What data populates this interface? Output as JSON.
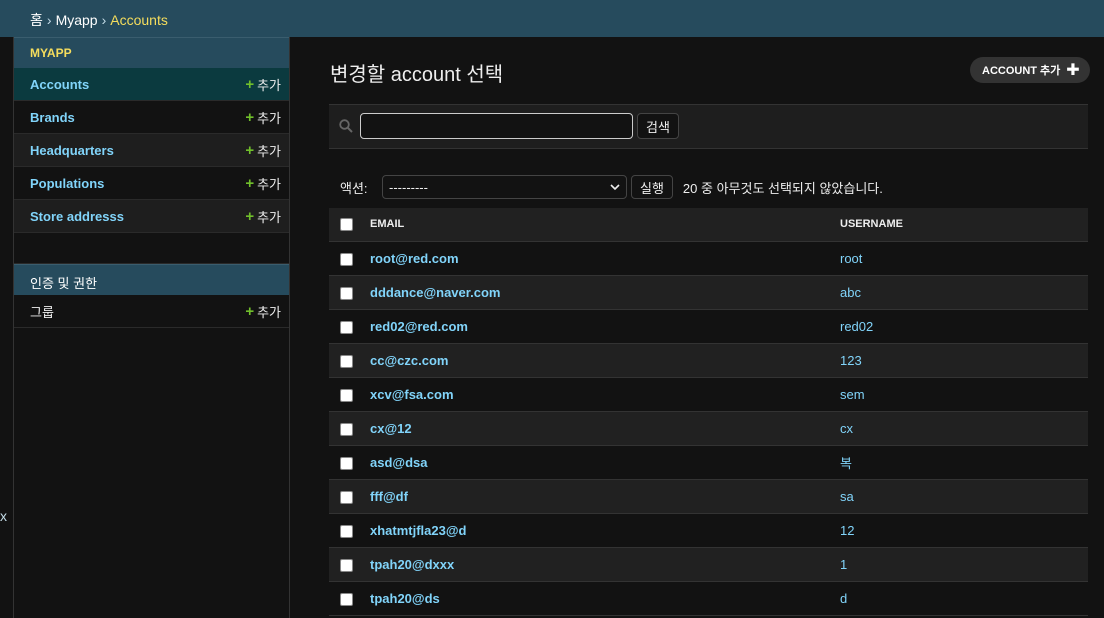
{
  "breadcrumbs": {
    "home": "홈",
    "sep": "›",
    "app": "Myapp",
    "current": "Accounts"
  },
  "nav_toggle": "x",
  "sidebar": {
    "app_caption": "MYAPP",
    "add_label": "추가",
    "models": [
      {
        "label": "Accounts",
        "current": true
      },
      {
        "label": "Brands"
      },
      {
        "label": "Headquarters"
      },
      {
        "label": "Populations"
      },
      {
        "label": "Store addresss"
      }
    ],
    "auth_caption": "인증 및 권한",
    "auth_models": [
      {
        "label": "그룹"
      }
    ]
  },
  "main": {
    "title": "변경할 account 선택",
    "add_button": "ACCOUNT 추가",
    "search": {
      "value": "",
      "button": "검색"
    },
    "actions": {
      "label": "액션:",
      "selected": "---------",
      "go": "실행",
      "counter": "20 중 아무것도 선택되지 않았습니다."
    },
    "table": {
      "columns": [
        "EMAIL",
        "USERNAME"
      ],
      "rows": [
        {
          "email": "root@red.com",
          "username": "root"
        },
        {
          "email": "dddance@naver.com",
          "username": "abc"
        },
        {
          "email": "red02@red.com",
          "username": "red02"
        },
        {
          "email": "cc@czc.com",
          "username": "123"
        },
        {
          "email": "xcv@fsa.com",
          "username": "sem"
        },
        {
          "email": "cx@12",
          "username": "cx"
        },
        {
          "email": "asd@dsa",
          "username": "복"
        },
        {
          "email": "fff@df",
          "username": "sa"
        },
        {
          "email": "xhatmtjfla23@d",
          "username": "12"
        },
        {
          "email": "tpah20@dxxx",
          "username": "1"
        },
        {
          "email": "tpah20@ds",
          "username": "d"
        }
      ]
    }
  },
  "colors": {
    "header": "#264b5d",
    "link": "#81d4fa",
    "add_plus": "#70bf2b",
    "caption_text": "#f5dd5d"
  },
  "icons": {
    "search": "search-icon",
    "add": "plus-icon",
    "select_arrow": "chevron-down-icon"
  }
}
